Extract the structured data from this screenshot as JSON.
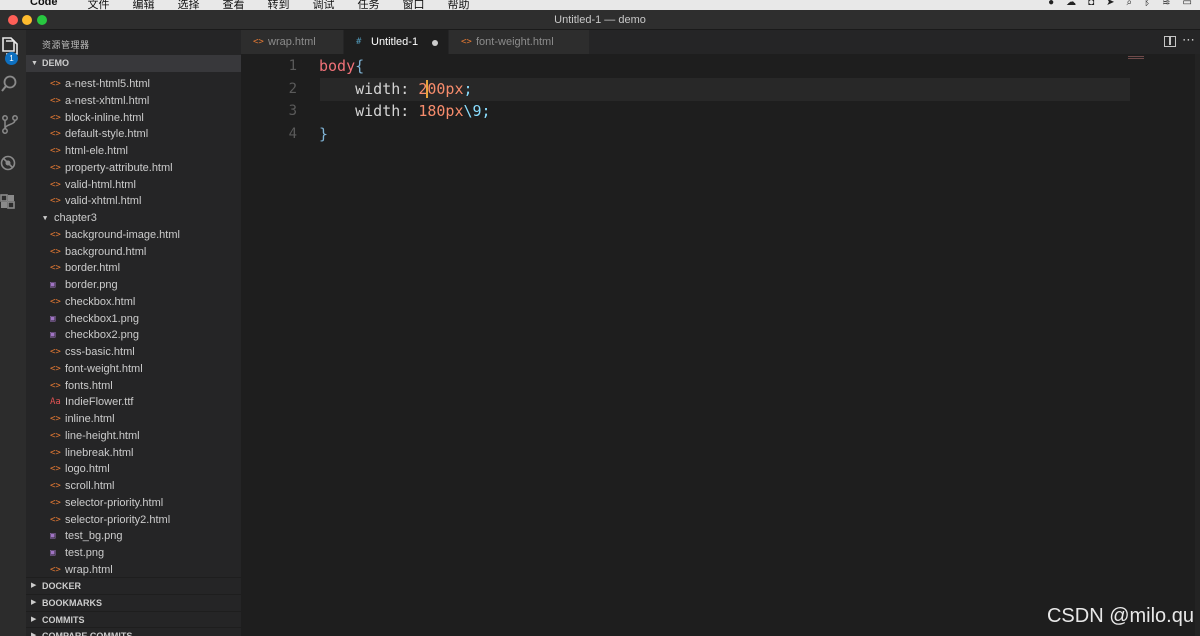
{
  "menubar": {
    "apple_glyph": "",
    "items": [
      "Code",
      "文件",
      "编辑",
      "选择",
      "查看",
      "转到",
      "调试",
      "任务",
      "窗口",
      "帮助"
    ]
  },
  "window": {
    "title": "Untitled-1 — demo"
  },
  "activity": {
    "badge": "1"
  },
  "sidebar": {
    "title": "资源管理器",
    "root": "DEMO",
    "files": [
      {
        "name": "a-nest-html5.html",
        "type": "html"
      },
      {
        "name": "a-nest-xhtml.html",
        "type": "html"
      },
      {
        "name": "block-inline.html",
        "type": "html"
      },
      {
        "name": "default-style.html",
        "type": "html"
      },
      {
        "name": "html-ele.html",
        "type": "html"
      },
      {
        "name": "property-attribute.html",
        "type": "html"
      },
      {
        "name": "valid-html.html",
        "type": "html"
      },
      {
        "name": "valid-xhtml.html",
        "type": "html"
      },
      {
        "name": "chapter3",
        "type": "folder"
      },
      {
        "name": "background-image.html",
        "type": "html"
      },
      {
        "name": "background.html",
        "type": "html"
      },
      {
        "name": "border.html",
        "type": "html"
      },
      {
        "name": "border.png",
        "type": "png"
      },
      {
        "name": "checkbox.html",
        "type": "html"
      },
      {
        "name": "checkbox1.png",
        "type": "png"
      },
      {
        "name": "checkbox2.png",
        "type": "png"
      },
      {
        "name": "css-basic.html",
        "type": "html"
      },
      {
        "name": "font-weight.html",
        "type": "html"
      },
      {
        "name": "fonts.html",
        "type": "html"
      },
      {
        "name": "IndieFlower.ttf",
        "type": "font"
      },
      {
        "name": "inline.html",
        "type": "html"
      },
      {
        "name": "line-height.html",
        "type": "html"
      },
      {
        "name": "linebreak.html",
        "type": "html"
      },
      {
        "name": "logo.html",
        "type": "html"
      },
      {
        "name": "scroll.html",
        "type": "html"
      },
      {
        "name": "selector-priority.html",
        "type": "html"
      },
      {
        "name": "selector-priority2.html",
        "type": "html"
      },
      {
        "name": "test_bg.png",
        "type": "png"
      },
      {
        "name": "test.png",
        "type": "png"
      },
      {
        "name": "wrap.html",
        "type": "html"
      }
    ],
    "sections": [
      "DOCKER",
      "BOOKMARKS",
      "COMMITS",
      "COMPARE COMMITS"
    ]
  },
  "tabs": [
    {
      "label": "wrap.html",
      "icon": "<>"
    },
    {
      "label": "Untitled-1",
      "icon": "#"
    },
    {
      "label": "font-weight.html",
      "icon": "<>"
    }
  ],
  "editor": {
    "line_numbers": [
      "1",
      "2",
      "3",
      "4"
    ],
    "line1": {
      "selector": "body",
      "brace": "{"
    },
    "line2": {
      "indent": "    ",
      "prop": "width: ",
      "num_a": "2",
      "num_b": "00px",
      "punct": ";"
    },
    "line3": {
      "indent": "    ",
      "prop": "width: ",
      "num": "180px",
      "punct": "\\9;"
    },
    "line4": {
      "brace": "}"
    }
  },
  "watermark": "CSDN @milo.qu"
}
